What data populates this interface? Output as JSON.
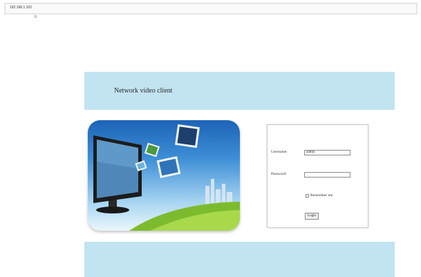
{
  "browser": {
    "address": "192.168.1.102"
  },
  "cursor_mark": "0",
  "header": {
    "title": "Network video client"
  },
  "login": {
    "username_label": "Username:",
    "username_value": "admin",
    "password_label": "Password:",
    "password_value": "",
    "remember_label": "Remember me",
    "login_button": "Login"
  },
  "colors": {
    "banner": "#c2e3f1",
    "sky_top": "#1d63b7",
    "grass": "#7dbb2e"
  }
}
